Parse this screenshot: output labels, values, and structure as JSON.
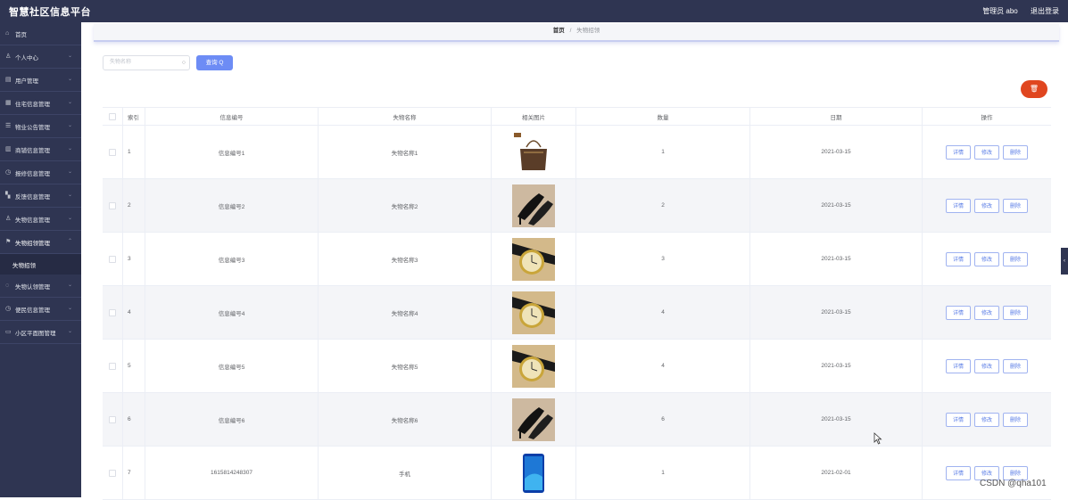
{
  "app": {
    "title": "智慧社区信息平台",
    "user_label": "管理员 abo",
    "logout_label": "退出登录"
  },
  "sidebar": {
    "items": [
      {
        "label": "首页",
        "icon": "home-icon",
        "chev": ""
      },
      {
        "label": "个人中心",
        "icon": "user-icon",
        "chev": "⌄"
      },
      {
        "label": "用户管理",
        "icon": "list-icon",
        "chev": "⌄"
      },
      {
        "label": "住宅信息管理",
        "icon": "building-icon",
        "chev": "⌄"
      },
      {
        "label": "物业公告管理",
        "icon": "notice-icon",
        "chev": "⌄"
      },
      {
        "label": "商铺信息管理",
        "icon": "shop-icon",
        "chev": "⌄"
      },
      {
        "label": "报修信息管理",
        "icon": "repair-icon",
        "chev": "⌄"
      },
      {
        "label": "反馈信息管理",
        "icon": "grid-icon",
        "chev": "⌄"
      },
      {
        "label": "失物信息管理",
        "icon": "person-icon",
        "chev": "⌄"
      },
      {
        "label": "失物招领管理",
        "icon": "flag-icon",
        "chev": "⌃"
      },
      {
        "label": "失物认领管理",
        "icon": "circle-icon",
        "chev": "⌄"
      },
      {
        "label": "便民信息管理",
        "icon": "clock-icon",
        "chev": "⌄"
      },
      {
        "label": "小区平面图管理",
        "icon": "map-icon",
        "chev": "⌄"
      }
    ],
    "submenu_label": "失物招领"
  },
  "breadcrumb": {
    "home": "首页",
    "separator": "/",
    "current": "失物招领"
  },
  "search": {
    "placeholder": "失物名称",
    "button_label": "查询 Q",
    "icon": "search-icon"
  },
  "toolbar": {
    "delete_label": "🗑"
  },
  "table": {
    "columns": [
      "",
      "索引",
      "信息编号",
      "失物名称",
      "相关图片",
      "数量",
      "日期",
      "操作"
    ],
    "rows": [
      {
        "index": "1",
        "no": "信息编号1",
        "name": "失物名称1",
        "image": "handbag",
        "qty": "1",
        "date": "2021-03-15"
      },
      {
        "index": "2",
        "no": "信息编号2",
        "name": "失物名称2",
        "image": "heels",
        "qty": "2",
        "date": "2021-03-15"
      },
      {
        "index": "3",
        "no": "信息编号3",
        "name": "失物名称3",
        "image": "watch",
        "qty": "3",
        "date": "2021-03-15"
      },
      {
        "index": "4",
        "no": "信息编号4",
        "name": "失物名称4",
        "image": "watch",
        "qty": "4",
        "date": "2021-03-15"
      },
      {
        "index": "5",
        "no": "信息编号5",
        "name": "失物名称5",
        "image": "watch",
        "qty": "4",
        "date": "2021-03-15"
      },
      {
        "index": "6",
        "no": "信息编号6",
        "name": "失物名称6",
        "image": "heels",
        "qty": "6",
        "date": "2021-03-15"
      },
      {
        "index": "7",
        "no": "1615814248307",
        "name": "手机",
        "image": "phone",
        "qty": "1",
        "date": "2021-02-01"
      }
    ],
    "actions": {
      "detail": "详情",
      "edit": "修改",
      "delete": "删除"
    }
  },
  "watermark": "CSDN @qha101",
  "collapse_icon": "‹"
}
